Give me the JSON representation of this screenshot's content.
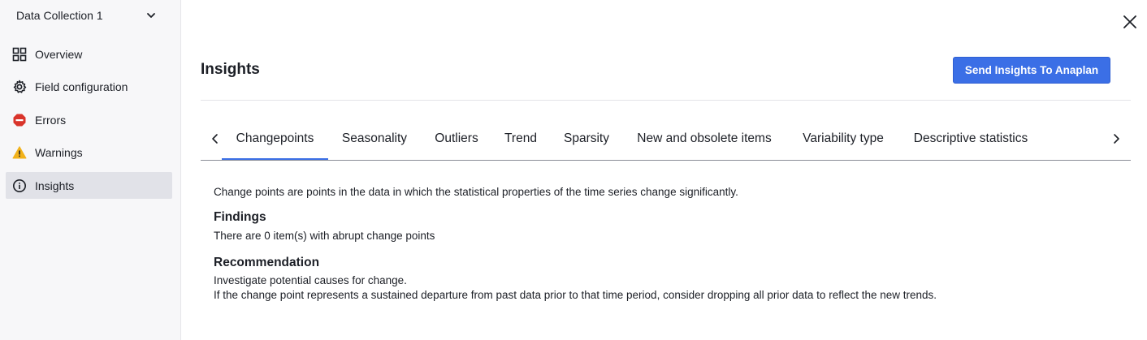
{
  "sidebar": {
    "collection": "Data Collection 1",
    "items": [
      {
        "label": "Overview",
        "icon": "grid-icon"
      },
      {
        "label": "Field configuration",
        "icon": "gear-icon"
      },
      {
        "label": "Errors",
        "icon": "error-icon"
      },
      {
        "label": "Warnings",
        "icon": "warning-icon"
      },
      {
        "label": "Insights",
        "icon": "info-icon",
        "active": true
      }
    ]
  },
  "header": {
    "title": "Insights",
    "send_button": "Send Insights To Anaplan"
  },
  "tabs": [
    {
      "label": "Changepoints",
      "active": true
    },
    {
      "label": "Seasonality"
    },
    {
      "label": "Outliers"
    },
    {
      "label": "Trend"
    },
    {
      "label": "Sparsity"
    },
    {
      "label": "New and obsolete items"
    },
    {
      "label": "Variability type"
    },
    {
      "label": "Descriptive statistics"
    }
  ],
  "content": {
    "description": "Change points are points in the data in which the statistical properties of the time series change significantly.",
    "findings_heading": "Findings",
    "findings_text": "There are 0 item(s) with abrupt change points",
    "recommendation_heading": "Recommendation",
    "recommendation_line1": "Investigate potential causes for change.",
    "recommendation_line2": "If the change point represents a sustained departure from past data prior to that time period, consider dropping all prior data to reflect the new trends."
  },
  "colors": {
    "accent": "#3b6fe6",
    "error": "#d9342b",
    "warning": "#f2b21a",
    "sidebar_bg": "#f7f7f9",
    "active_item_bg": "#e1e2e8"
  }
}
